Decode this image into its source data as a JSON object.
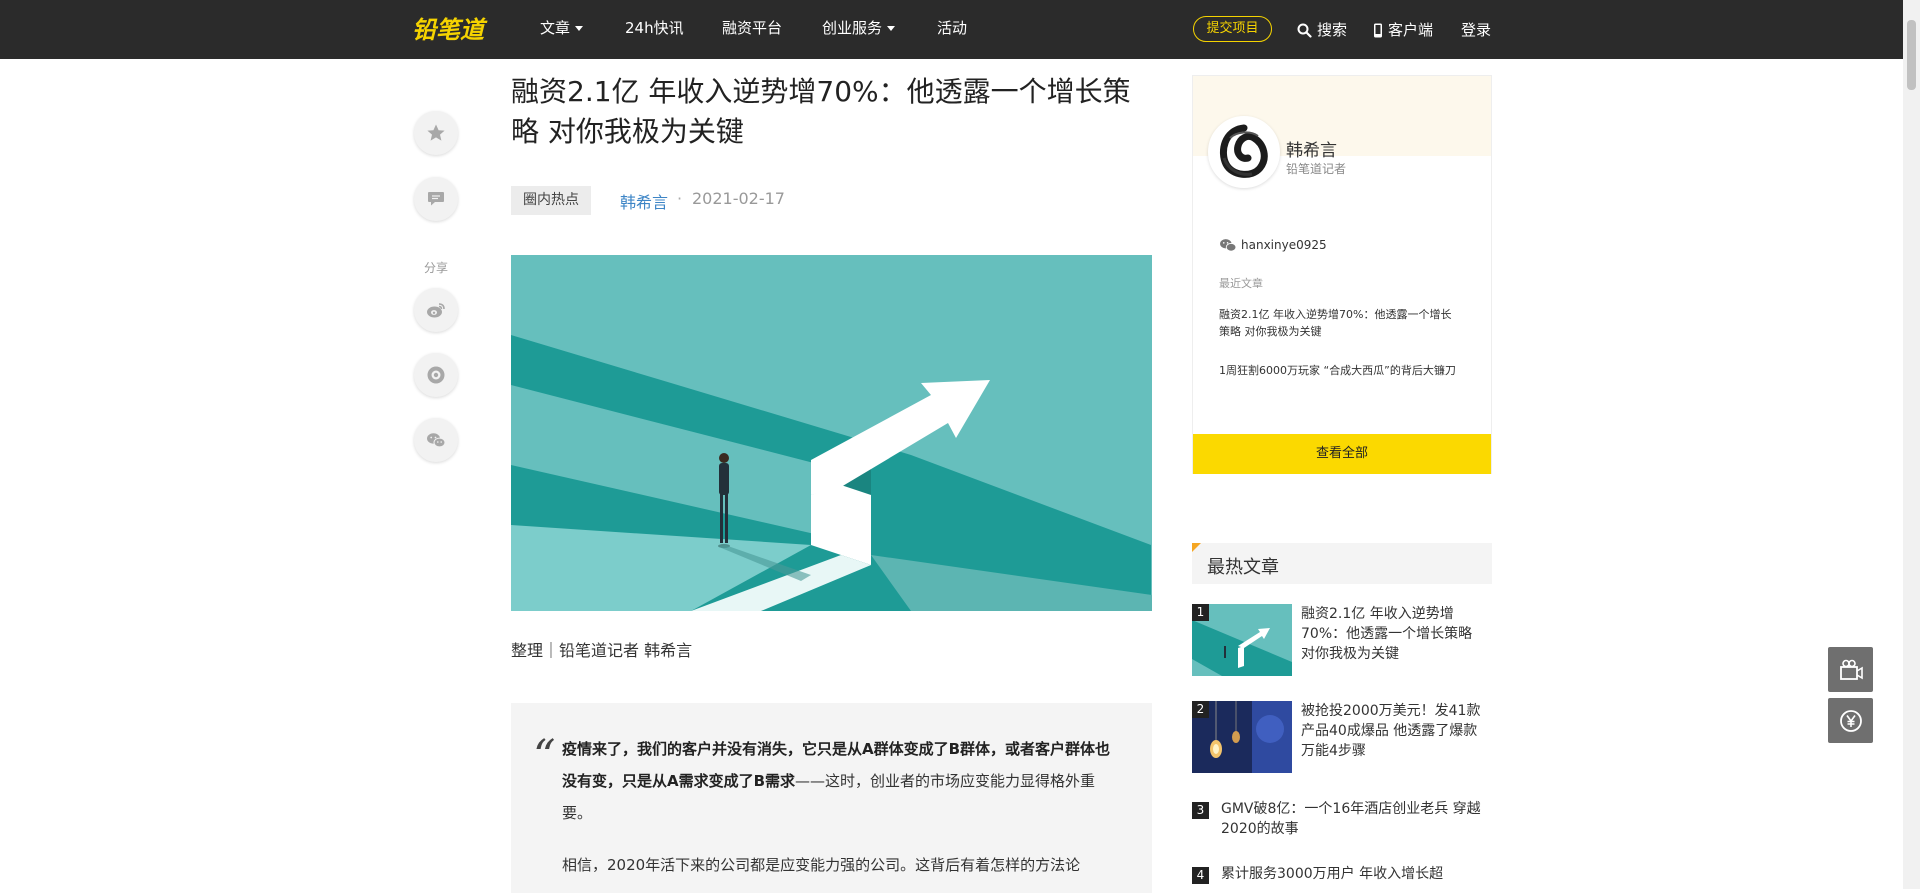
{
  "nav": {
    "logo_text": "铅笔道",
    "items": [
      "文章",
      "24h快讯",
      "融资平台",
      "创业服务",
      "活动"
    ],
    "submit_label": "提交项目",
    "search_label": "搜索",
    "client_label": "客户端",
    "login_label": "登录"
  },
  "side": {
    "share_label": "分享"
  },
  "article": {
    "title": "融资2.1亿 年收入逆势增70%：他透露一个增长策略 对你我极为关键",
    "tag": "圈内热点",
    "author": "韩希言",
    "dot": "·",
    "date": "2021-02-17",
    "byline": "整理｜铅笔道记者 韩希言",
    "quote_mark": "“",
    "quote_bold": "疫情来了，我们的客户并没有消失，它只是从A群体变成了B群体，或者客户群体也没有变，只是从A需求变成了B需求",
    "quote_rest": "——这时，创业者的市场应变能力显得格外重要。",
    "para2": "相信，2020年活下来的公司都是应变能力强的公司。这背后有着怎样的方法论"
  },
  "author_card": {
    "name": "韩希言",
    "role": "铅笔道记者",
    "wechat": "hanxinye0925",
    "recent_label": "最近文章",
    "recent": [
      "融资2.1亿 年收入逆势增70%：他透露一个增长策略 对你我极为关键",
      "1周狂割6000万玩家 “合成大西瓜”的背后大镰刀"
    ],
    "view_all": "查看全部"
  },
  "hot": {
    "title": "最热文章",
    "items": [
      {
        "rank": "1",
        "title": "融资2.1亿 年收入逆势增70%：他透露一个增长策略 对你我极为关键"
      },
      {
        "rank": "2",
        "title": "被抢投2000万美元！发41款产品40成爆品 他透露了爆款万能4步骤"
      },
      {
        "rank": "3",
        "title": "GMV破8亿：一个16年酒店创业老兵 穿越2020的故事"
      },
      {
        "rank": "4",
        "title": "累计服务3000万用户 年收入增长超"
      }
    ]
  },
  "colors": {
    "nav_bg": "#2b2b2b",
    "accent_yellow": "#fbd900",
    "link_blue": "#3d85c6",
    "hero_teal": "#66bfbd"
  },
  "icons": [
    "star-icon",
    "comment-icon",
    "weibo-icon",
    "qzone-icon",
    "wechat-icon",
    "search-icon",
    "phone-icon",
    "gift-icon",
    "yuan-icon"
  ]
}
